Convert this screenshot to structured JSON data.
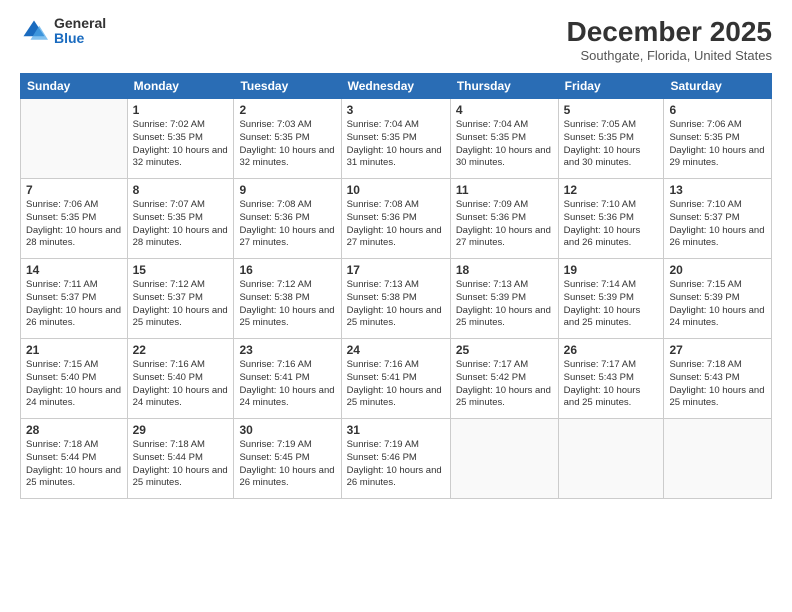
{
  "header": {
    "logo_general": "General",
    "logo_blue": "Blue",
    "month_title": "December 2025",
    "location": "Southgate, Florida, United States"
  },
  "weekdays": [
    "Sunday",
    "Monday",
    "Tuesday",
    "Wednesday",
    "Thursday",
    "Friday",
    "Saturday"
  ],
  "weeks": [
    [
      {
        "day": "",
        "info": ""
      },
      {
        "day": "1",
        "info": "Sunrise: 7:02 AM\nSunset: 5:35 PM\nDaylight: 10 hours\nand 32 minutes."
      },
      {
        "day": "2",
        "info": "Sunrise: 7:03 AM\nSunset: 5:35 PM\nDaylight: 10 hours\nand 32 minutes."
      },
      {
        "day": "3",
        "info": "Sunrise: 7:04 AM\nSunset: 5:35 PM\nDaylight: 10 hours\nand 31 minutes."
      },
      {
        "day": "4",
        "info": "Sunrise: 7:04 AM\nSunset: 5:35 PM\nDaylight: 10 hours\nand 30 minutes."
      },
      {
        "day": "5",
        "info": "Sunrise: 7:05 AM\nSunset: 5:35 PM\nDaylight: 10 hours\nand 30 minutes."
      },
      {
        "day": "6",
        "info": "Sunrise: 7:06 AM\nSunset: 5:35 PM\nDaylight: 10 hours\nand 29 minutes."
      }
    ],
    [
      {
        "day": "7",
        "info": "Sunrise: 7:06 AM\nSunset: 5:35 PM\nDaylight: 10 hours\nand 28 minutes."
      },
      {
        "day": "8",
        "info": "Sunrise: 7:07 AM\nSunset: 5:35 PM\nDaylight: 10 hours\nand 28 minutes."
      },
      {
        "day": "9",
        "info": "Sunrise: 7:08 AM\nSunset: 5:36 PM\nDaylight: 10 hours\nand 27 minutes."
      },
      {
        "day": "10",
        "info": "Sunrise: 7:08 AM\nSunset: 5:36 PM\nDaylight: 10 hours\nand 27 minutes."
      },
      {
        "day": "11",
        "info": "Sunrise: 7:09 AM\nSunset: 5:36 PM\nDaylight: 10 hours\nand 27 minutes."
      },
      {
        "day": "12",
        "info": "Sunrise: 7:10 AM\nSunset: 5:36 PM\nDaylight: 10 hours\nand 26 minutes."
      },
      {
        "day": "13",
        "info": "Sunrise: 7:10 AM\nSunset: 5:37 PM\nDaylight: 10 hours\nand 26 minutes."
      }
    ],
    [
      {
        "day": "14",
        "info": "Sunrise: 7:11 AM\nSunset: 5:37 PM\nDaylight: 10 hours\nand 26 minutes."
      },
      {
        "day": "15",
        "info": "Sunrise: 7:12 AM\nSunset: 5:37 PM\nDaylight: 10 hours\nand 25 minutes."
      },
      {
        "day": "16",
        "info": "Sunrise: 7:12 AM\nSunset: 5:38 PM\nDaylight: 10 hours\nand 25 minutes."
      },
      {
        "day": "17",
        "info": "Sunrise: 7:13 AM\nSunset: 5:38 PM\nDaylight: 10 hours\nand 25 minutes."
      },
      {
        "day": "18",
        "info": "Sunrise: 7:13 AM\nSunset: 5:39 PM\nDaylight: 10 hours\nand 25 minutes."
      },
      {
        "day": "19",
        "info": "Sunrise: 7:14 AM\nSunset: 5:39 PM\nDaylight: 10 hours\nand 25 minutes."
      },
      {
        "day": "20",
        "info": "Sunrise: 7:15 AM\nSunset: 5:39 PM\nDaylight: 10 hours\nand 24 minutes."
      }
    ],
    [
      {
        "day": "21",
        "info": "Sunrise: 7:15 AM\nSunset: 5:40 PM\nDaylight: 10 hours\nand 24 minutes."
      },
      {
        "day": "22",
        "info": "Sunrise: 7:16 AM\nSunset: 5:40 PM\nDaylight: 10 hours\nand 24 minutes."
      },
      {
        "day": "23",
        "info": "Sunrise: 7:16 AM\nSunset: 5:41 PM\nDaylight: 10 hours\nand 24 minutes."
      },
      {
        "day": "24",
        "info": "Sunrise: 7:16 AM\nSunset: 5:41 PM\nDaylight: 10 hours\nand 25 minutes."
      },
      {
        "day": "25",
        "info": "Sunrise: 7:17 AM\nSunset: 5:42 PM\nDaylight: 10 hours\nand 25 minutes."
      },
      {
        "day": "26",
        "info": "Sunrise: 7:17 AM\nSunset: 5:43 PM\nDaylight: 10 hours\nand 25 minutes."
      },
      {
        "day": "27",
        "info": "Sunrise: 7:18 AM\nSunset: 5:43 PM\nDaylight: 10 hours\nand 25 minutes."
      }
    ],
    [
      {
        "day": "28",
        "info": "Sunrise: 7:18 AM\nSunset: 5:44 PM\nDaylight: 10 hours\nand 25 minutes."
      },
      {
        "day": "29",
        "info": "Sunrise: 7:18 AM\nSunset: 5:44 PM\nDaylight: 10 hours\nand 25 minutes."
      },
      {
        "day": "30",
        "info": "Sunrise: 7:19 AM\nSunset: 5:45 PM\nDaylight: 10 hours\nand 26 minutes."
      },
      {
        "day": "31",
        "info": "Sunrise: 7:19 AM\nSunset: 5:46 PM\nDaylight: 10 hours\nand 26 minutes."
      },
      {
        "day": "",
        "info": ""
      },
      {
        "day": "",
        "info": ""
      },
      {
        "day": "",
        "info": ""
      }
    ]
  ]
}
